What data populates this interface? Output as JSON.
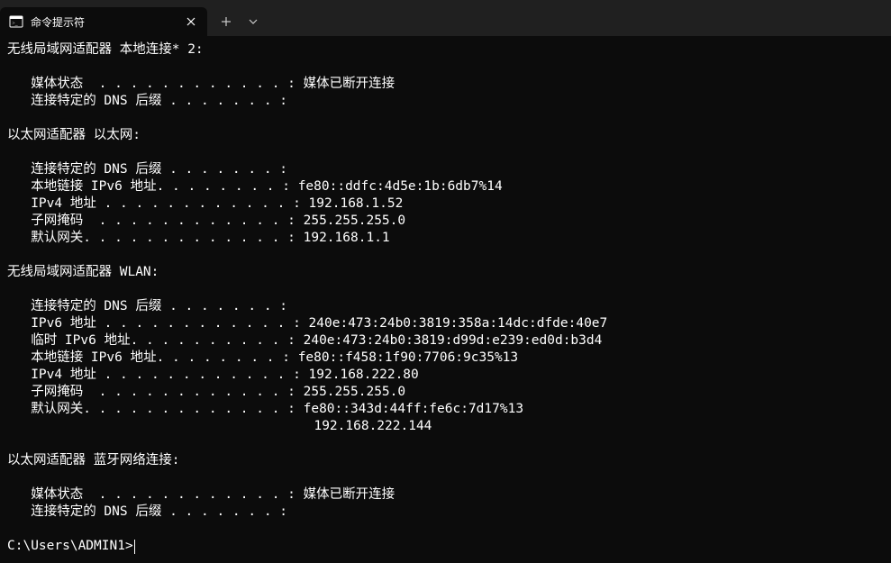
{
  "titlebar": {
    "tab_title": "命令提示符",
    "new_tab_label": "+",
    "dropdown_label": "⌄"
  },
  "sections": [
    {
      "header": "无线局域网适配器 本地连接* 2:",
      "lines": [
        "   媒体状态  . . . . . . . . . . . . : 媒体已断开连接",
        "   连接特定的 DNS 后缀 . . . . . . . :"
      ]
    },
    {
      "header": "以太网适配器 以太网:",
      "lines": [
        "   连接特定的 DNS 后缀 . . . . . . . :",
        "   本地链接 IPv6 地址. . . . . . . . : fe80::ddfc:4d5e:1b:6db7%14",
        "   IPv4 地址 . . . . . . . . . . . . : 192.168.1.52",
        "   子网掩码  . . . . . . . . . . . . : 255.255.255.0",
        "   默认网关. . . . . . . . . . . . . : 192.168.1.1"
      ]
    },
    {
      "header": "无线局域网适配器 WLAN:",
      "lines": [
        "   连接特定的 DNS 后缀 . . . . . . . :",
        "   IPv6 地址 . . . . . . . . . . . . : 240e:473:24b0:3819:358a:14dc:dfde:40e7",
        "   临时 IPv6 地址. . . . . . . . . . : 240e:473:24b0:3819:d99d:e239:ed0d:b3d4",
        "   本地链接 IPv6 地址. . . . . . . . : fe80::f458:1f90:7706:9c35%13",
        "   IPv4 地址 . . . . . . . . . . . . : 192.168.222.80",
        "   子网掩码  . . . . . . . . . . . . : 255.255.255.0",
        "   默认网关. . . . . . . . . . . . . : fe80::343d:44ff:fe6c:7d17%13",
        "                                       192.168.222.144"
      ]
    },
    {
      "header": "以太网适配器 蓝牙网络连接:",
      "lines": [
        "   媒体状态  . . . . . . . . . . . . : 媒体已断开连接",
        "   连接特定的 DNS 后缀 . . . . . . . :"
      ]
    }
  ],
  "prompt": "C:\\Users\\ADMIN1>"
}
